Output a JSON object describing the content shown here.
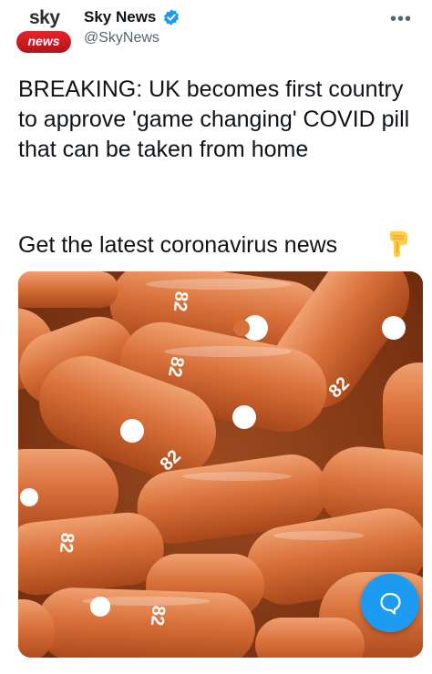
{
  "account": {
    "avatar_top": "sky",
    "avatar_bottom": "news",
    "display_name": "Sky News",
    "handle": "@SkyNews",
    "verified_icon": "verified-badge-icon",
    "more_icon": "more-options-icon"
  },
  "tweet": {
    "text": "BREAKING: UK becomes first country to approve 'game changing' COVID pill that can be taken from home",
    "cta": "Get the latest coronavirus news",
    "cta_emoji_icon": "pointing-down-hand-icon"
  },
  "media": {
    "image_icon": "capsules-photo",
    "capsule_imprint": "82"
  },
  "fab": {
    "icon": "compose-reply-icon"
  },
  "colors": {
    "accent": "#1d9bf0",
    "brand_red": "#d81e26",
    "capsule_orange": "#d96f35"
  }
}
